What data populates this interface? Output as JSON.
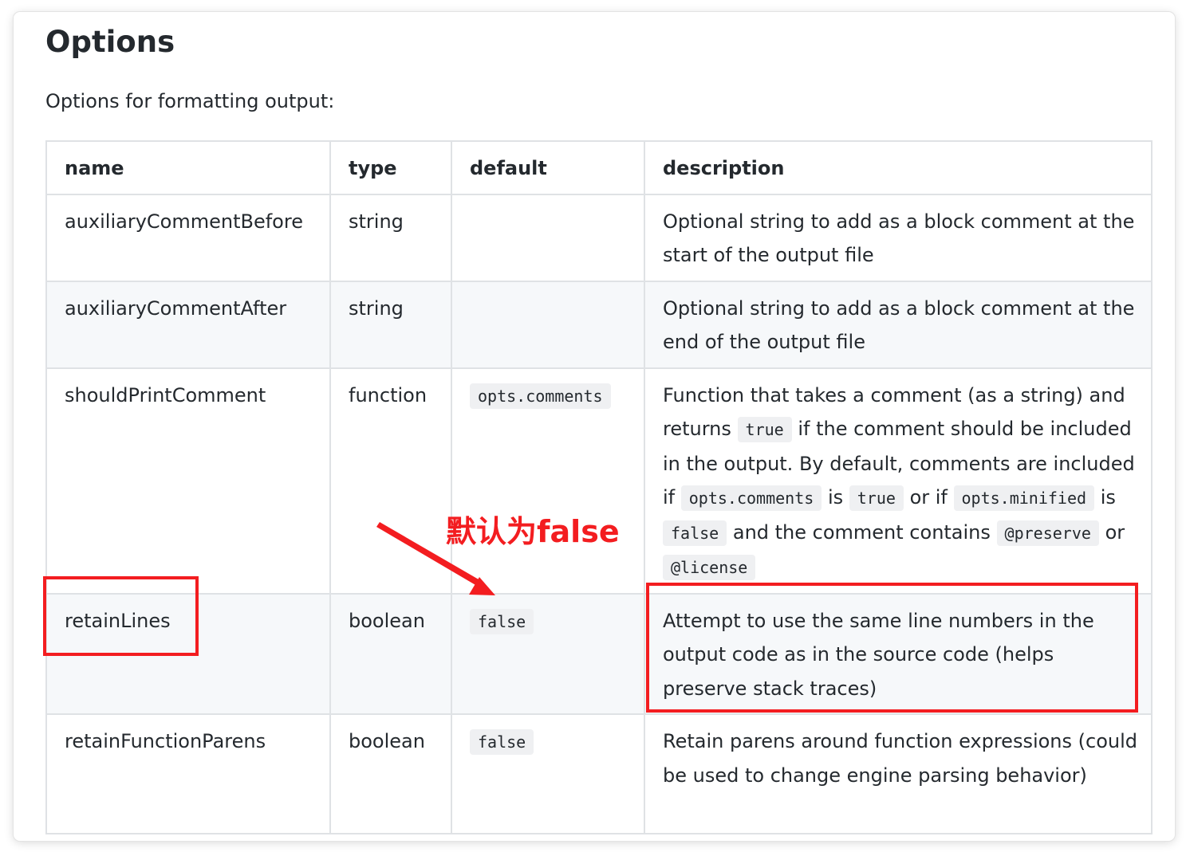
{
  "page": {
    "title": "Options",
    "intro": "Options for formatting output:"
  },
  "table": {
    "headers": [
      "name",
      "type",
      "default",
      "description"
    ],
    "rows": [
      {
        "name": "auxiliaryCommentBefore",
        "type": "string",
        "default": "",
        "description": [
          {
            "text": "Optional string to add as a block comment at the start of the output file"
          }
        ]
      },
      {
        "name": "auxiliaryCommentAfter",
        "type": "string",
        "default": "",
        "description": [
          {
            "text": "Optional string to add as a block comment at the end of the output file"
          }
        ]
      },
      {
        "name": "shouldPrintComment",
        "type": "function",
        "default": "opts.comments",
        "description": [
          {
            "text": "Function that takes a comment (as a string) and returns"
          },
          {
            "code": "true"
          },
          {
            "text": "if the comment should be included in the output. By default, comments are included if"
          },
          {
            "code": "opts.comments"
          },
          {
            "text": "is"
          },
          {
            "code": "true"
          },
          {
            "text": "or if"
          },
          {
            "code": "opts.minified"
          },
          {
            "text": "is"
          },
          {
            "code": "false"
          },
          {
            "text": "and the comment contains"
          },
          {
            "code": "@preserve"
          },
          {
            "text": "or"
          },
          {
            "code": "@license"
          }
        ]
      },
      {
        "name": "retainLines",
        "type": "boolean",
        "default": "false",
        "description": [
          {
            "text": "Attempt to use the same line numbers in the output code as in the source code (helps preserve stack traces)"
          }
        ]
      },
      {
        "name": "retainFunctionParens",
        "type": "boolean",
        "default": "false",
        "description": [
          {
            "text": "Retain parens around function expressions (could be used to change engine parsing behavior)"
          }
        ]
      }
    ]
  },
  "annotation": {
    "text": "默认为false",
    "color": "#f31d20",
    "highlighted_row": "retainLines"
  },
  "colors": {
    "text": "#24292e",
    "border": "#dfe2e5",
    "stripe": "#f6f8fa",
    "code_bg": "#eff0f2",
    "annotation": "#f31d20"
  }
}
